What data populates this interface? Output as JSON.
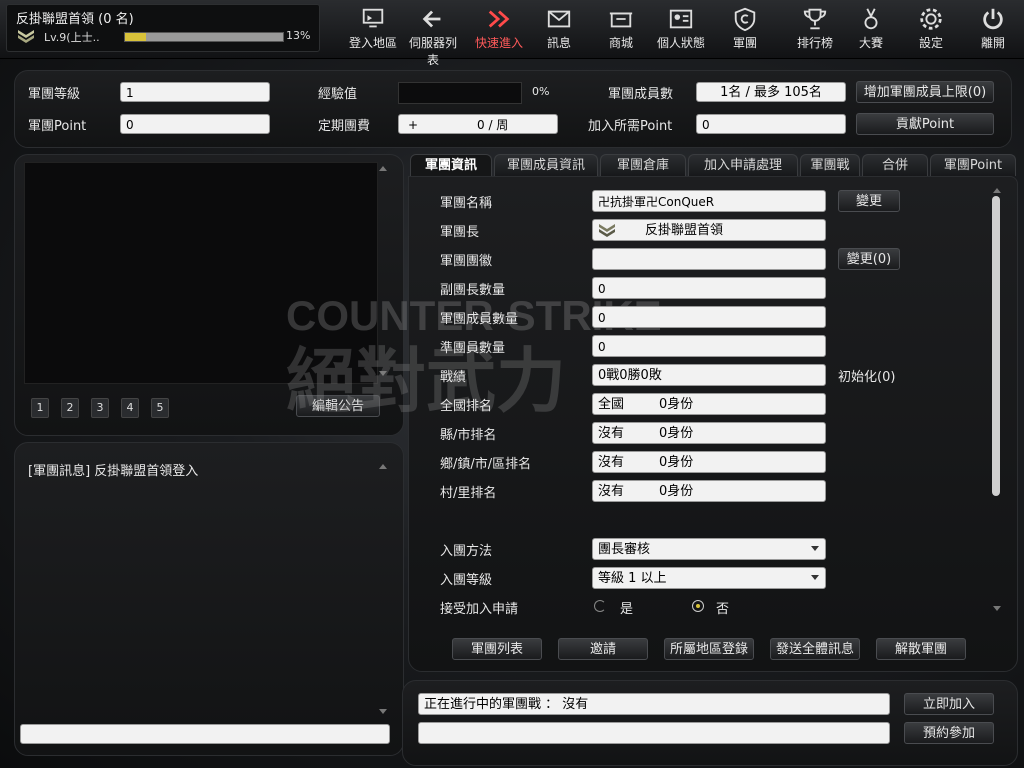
{
  "player": {
    "name": "反掛聯盟首領 (0 名)",
    "level": "Lv.9(上士..",
    "xp_fill": 0.13,
    "xp_pct": "13%"
  },
  "nav": [
    {
      "label": "登入地區",
      "icon": "monitor-icon"
    },
    {
      "label": "伺服器列表",
      "icon": "arrow-left-icon"
    },
    {
      "label": "快速進入",
      "icon": "fast-forward-icon"
    },
    {
      "label": "訊息",
      "icon": "mail-icon"
    },
    {
      "label": "商城",
      "icon": "shop-icon"
    },
    {
      "label": "個人狀態",
      "icon": "profile-card-icon"
    },
    {
      "label": "軍團",
      "icon": "clan-shield-icon"
    },
    {
      "label": "排行榜",
      "icon": "trophy-icon"
    },
    {
      "label": "大賽",
      "icon": "medal-icon"
    },
    {
      "label": "設定",
      "icon": "gear-icon"
    },
    {
      "label": "離開",
      "icon": "power-icon"
    }
  ],
  "summary": {
    "clan_level_label": "軍團等級",
    "clan_level": "1",
    "clan_point_label": "軍團Point",
    "clan_point": "0",
    "exp_label": "經驗值",
    "exp_pct": "0%",
    "fee_label": "定期團費",
    "fee_sign": "+",
    "fee_value": "0 / 周",
    "members_label": "軍團成員數",
    "members_value": "1名 / 最多 105名",
    "join_point_label": "加入所需Point",
    "join_point_value": "0",
    "increase_button": "增加軍團成員上限(0)",
    "contribute_button": "貢獻Point"
  },
  "notice": {
    "pages": [
      "1",
      "2",
      "3",
      "4",
      "5"
    ],
    "edit_button": "編輯公告"
  },
  "chat": {
    "message": "[軍團訊息] 反掛聯盟首領登入",
    "input": ""
  },
  "tabs": [
    "軍團資訊",
    "軍團成員資訊",
    "軍團倉庫",
    "加入申請處理",
    "軍團戰",
    "合併",
    "軍團Point"
  ],
  "info": {
    "name_label": "軍團名稱",
    "name_value": "卍抗掛軍卍ConQueR",
    "name_change": "變更",
    "leader_label": "軍團長",
    "leader_value": "反掛聯盟首領",
    "emblem_label": "軍團團徽",
    "emblem_value": "",
    "emblem_change": "變更(0)",
    "vice_label": "副團長數量",
    "vice_value": "0",
    "member_label": "軍團成員數量",
    "member_value": "0",
    "assoc_label": "準團員數量",
    "assoc_value": "0",
    "record_label": "戰績",
    "record_value": "0戰0勝0敗",
    "reset_button": "初始化(0)",
    "rank_nat_label": "全國排名",
    "rank_nat_scope": "全國",
    "rank_nat_value": "0身份",
    "rank_city_label": "縣/市排名",
    "rank_city_scope": "沒有",
    "rank_city_value": "0身份",
    "rank_town_label": "鄉/鎮/市/區排名",
    "rank_town_scope": "沒有",
    "rank_town_value": "0身份",
    "rank_vil_label": "村/里排名",
    "rank_vil_scope": "沒有",
    "rank_vil_value": "0身份",
    "join_method_label": "入團方法",
    "join_method_value": "團長審核",
    "join_level_label": "入團等級",
    "join_level_value": "等級 1 以上",
    "accept_label": "接受加入申請",
    "accept_yes": "是",
    "accept_no": "否",
    "accept_selected": "否"
  },
  "actions": [
    "軍團列表",
    "邀請",
    "所屬地區登錄",
    "發送全體訊息",
    "解散軍團"
  ],
  "war": {
    "status": "正在進行中的軍團戰 ： 沒有",
    "join_now": "立即加入",
    "reserve": "預約參加",
    "input": ""
  },
  "colors": {
    "active_nav": "#ff5a5a",
    "xp_bar": "#d8c23a"
  }
}
